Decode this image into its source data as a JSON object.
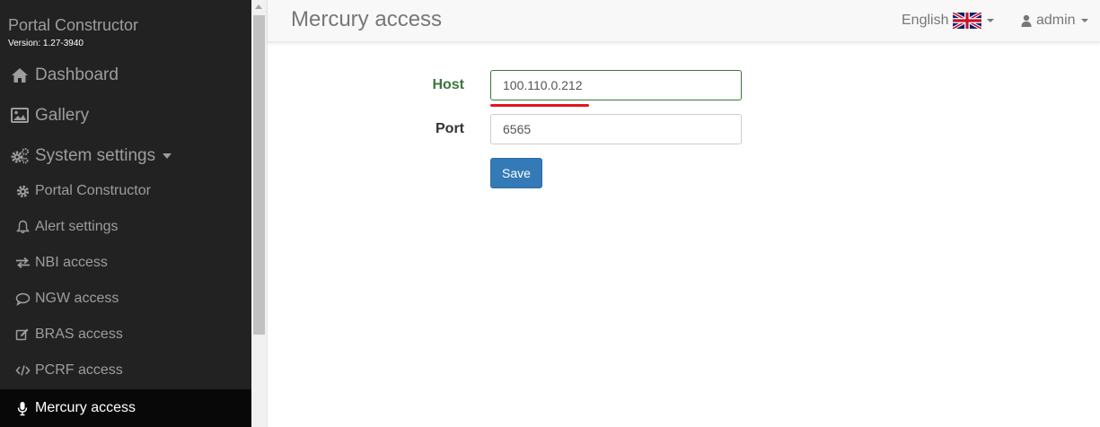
{
  "sidebar": {
    "brand": "Portal Constructor",
    "version": "Version: 1.27-3940",
    "top_items": [
      {
        "label": "Dashboard",
        "icon": "home-icon"
      },
      {
        "label": "Gallery",
        "icon": "picture-icon"
      },
      {
        "label": "System settings",
        "icon": "cogs-icon"
      }
    ],
    "sub_items": [
      {
        "label": "Portal Constructor",
        "icon": "cog-icon"
      },
      {
        "label": "Alert settings",
        "icon": "bell-icon"
      },
      {
        "label": "NBI access",
        "icon": "arrows-exchange-icon"
      },
      {
        "label": "NGW access",
        "icon": "comment-icon"
      },
      {
        "label": "BRAS access",
        "icon": "edit-icon"
      },
      {
        "label": "PCRF access",
        "icon": "code-icon"
      },
      {
        "label": "Mercury access",
        "icon": "microphone-icon",
        "active": true
      }
    ]
  },
  "header": {
    "title": "Mercury access",
    "language": "English",
    "language_flag": "uk-flag-icon",
    "user": "admin"
  },
  "form": {
    "host": {
      "label": "Host",
      "value": "100.110.0.212",
      "state": "success"
    },
    "port": {
      "label": "Port",
      "value": "6565"
    },
    "save_label": "Save"
  },
  "colors": {
    "sidebar_bg": "#222222",
    "sidebar_active_bg": "#080808",
    "success": "#3c763d",
    "primary": "#337ab7",
    "annotation": "#e3161b"
  }
}
